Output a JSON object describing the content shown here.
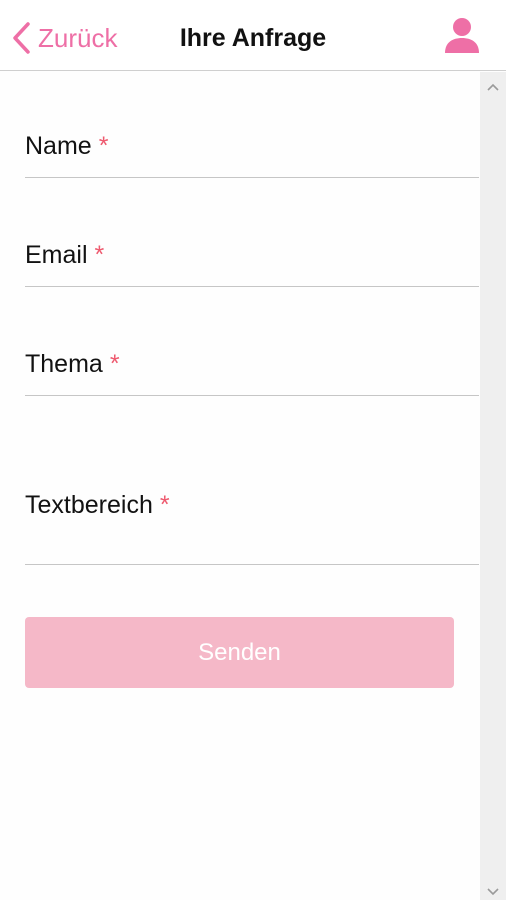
{
  "header": {
    "back_label": "Zurück",
    "title": "Ihre Anfrage",
    "back_icon": "chevron-left-icon",
    "user_icon": "user-icon"
  },
  "form": {
    "fields": [
      {
        "label": "Name",
        "required_mark": "*",
        "value": ""
      },
      {
        "label": "Email",
        "required_mark": "*",
        "value": ""
      },
      {
        "label": "Thema",
        "required_mark": "*",
        "value": ""
      },
      {
        "label": "Textbereich",
        "required_mark": "*",
        "value": ""
      }
    ],
    "submit_label": "Senden"
  },
  "colors": {
    "accent": "#ee6fa6",
    "required": "#ee5a6f",
    "submit_disabled": "#f5b8c8"
  }
}
